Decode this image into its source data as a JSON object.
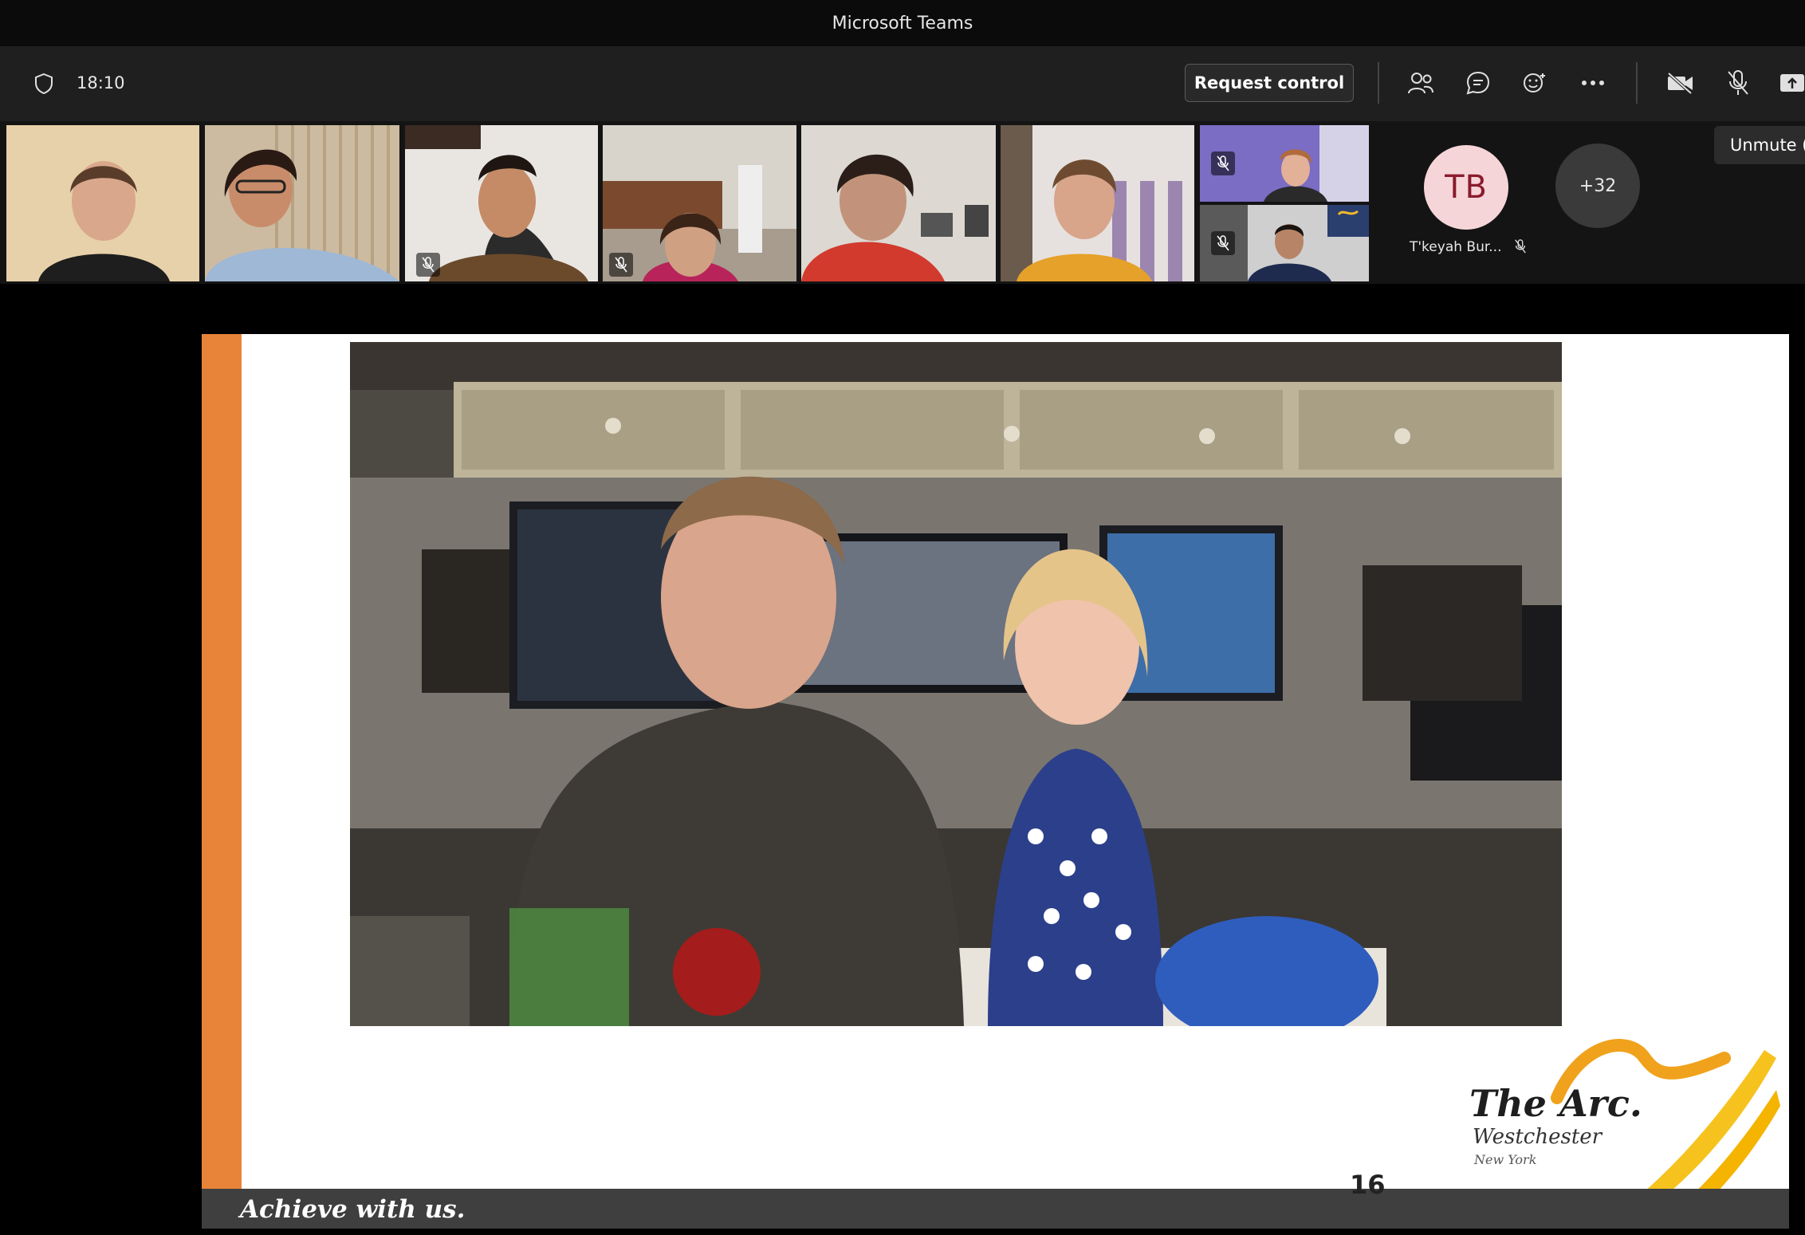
{
  "window": {
    "title": "Microsoft Teams"
  },
  "toolbar": {
    "time": "18:10",
    "request_control_label": "Request control",
    "icons": [
      "people-icon",
      "chat-icon",
      "reactions-icon",
      "more-icon",
      "camera-off-icon",
      "mic-off-icon",
      "share-icon"
    ]
  },
  "participants": {
    "avatar_initials": "TB",
    "avatar_name": "T'keyah Bur...",
    "overflow_count": "+32"
  },
  "tooltip": {
    "text": "Unmute (C"
  },
  "slide": {
    "tagline": "Achieve with us.",
    "page_number": "16",
    "logo_main": "The Arc.",
    "logo_sub": "Westchester",
    "logo_sub2": "New York"
  },
  "colors": {
    "accent": "#7f85f5",
    "slide_orange": "#e8833a",
    "slide_footer": "#3f3f3f",
    "avatar_bg": "#f6d5d9",
    "avatar_text": "#8a1b2c"
  }
}
